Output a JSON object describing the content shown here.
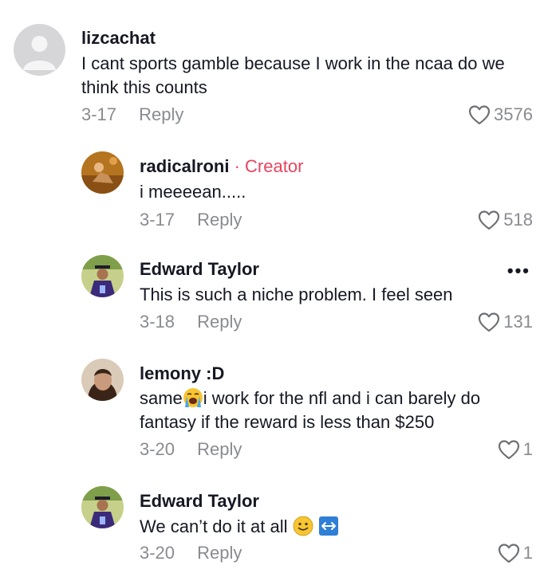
{
  "comments": [
    {
      "username": "lizcachat",
      "text": "I cant sports gamble because I work in the ncaa do we think this counts",
      "date": "3-17",
      "reply": "Reply",
      "likes": "3576",
      "avatar": "default-avatar"
    },
    {
      "username": "radicalroni",
      "badge": "· Creator",
      "text": "i meeeean.....",
      "date": "3-17",
      "reply": "Reply",
      "likes": "518",
      "avatar": "photo-avatar"
    },
    {
      "username": "Edward Taylor",
      "text": "This is such a niche problem. I feel seen",
      "date": "3-18",
      "reply": "Reply",
      "likes": "131",
      "more": "•••",
      "avatar": "photo-avatar"
    },
    {
      "username": "lemony :D",
      "text_before_emoji": "same",
      "emoji": "loudly-crying-face",
      "text_after_emoji": "i work for the nfl and i can barely do fantasy if the reward is less than $250",
      "date": "3-20",
      "reply": "Reply",
      "likes": "1",
      "avatar": "photo-avatar"
    },
    {
      "username": "Edward Taylor",
      "text": "We can’t do it at all",
      "emojis": [
        "slightly-smiling-face",
        "left-right-arrow"
      ],
      "date": "3-20",
      "reply": "Reply",
      "likes": "1",
      "avatar": "photo-avatar"
    }
  ],
  "colors": {
    "creator_badge": "#e8435f",
    "meta_text": "#8a8b91",
    "primary_text": "#161823"
  }
}
